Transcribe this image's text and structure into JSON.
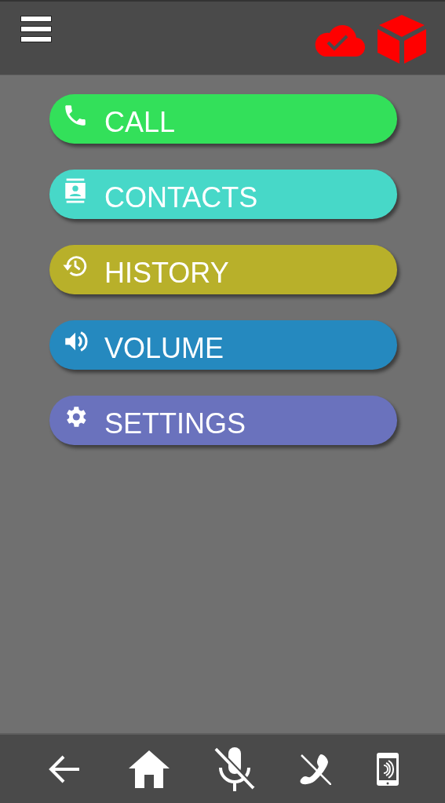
{
  "header": {
    "status_icons": [
      {
        "kind": "cloud-check"
      },
      {
        "kind": "cube"
      }
    ]
  },
  "menu": [
    {
      "label": "CALL",
      "color": "#33e05a",
      "kind": "phone"
    },
    {
      "label": "CONTACTS",
      "color": "#47d8c8",
      "kind": "contact"
    },
    {
      "label": "HISTORY",
      "color": "#b8b02a",
      "kind": "history"
    },
    {
      "label": "VOLUME",
      "color": "#2589bf",
      "kind": "volume"
    },
    {
      "label": "SETTINGS",
      "color": "#6a72bd",
      "kind": "gear"
    }
  ],
  "bottom_bar": [
    {
      "kind": "back"
    },
    {
      "kind": "home"
    },
    {
      "kind": "mic-off"
    },
    {
      "kind": "phone-off"
    },
    {
      "kind": "handset-signal"
    }
  ]
}
